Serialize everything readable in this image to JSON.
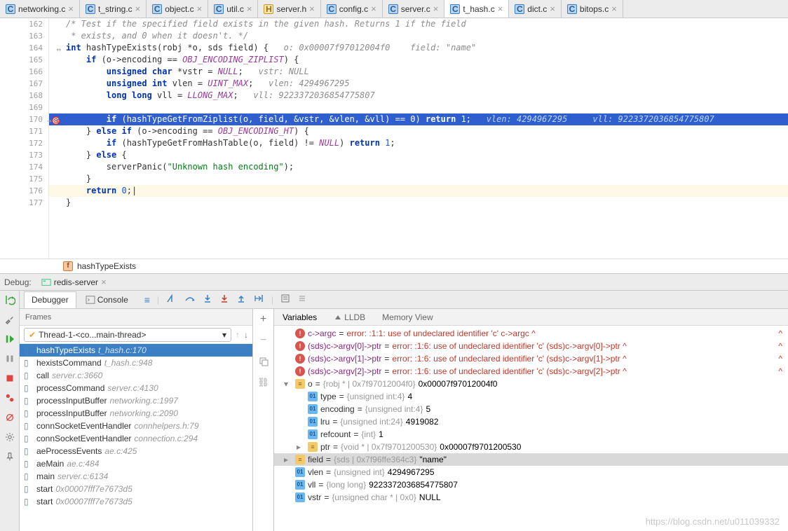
{
  "tabs": [
    {
      "name": "networking.c",
      "icon": "c"
    },
    {
      "name": "t_string.c",
      "icon": "c"
    },
    {
      "name": "object.c",
      "icon": "c"
    },
    {
      "name": "util.c",
      "icon": "c"
    },
    {
      "name": "server.h",
      "icon": "h"
    },
    {
      "name": "config.c",
      "icon": "c"
    },
    {
      "name": "server.c",
      "icon": "c"
    },
    {
      "name": "t_hash.c",
      "icon": "c",
      "active": true
    },
    {
      "name": "dict.c",
      "icon": "c"
    },
    {
      "name": "bitops.c",
      "icon": "c"
    }
  ],
  "editor": {
    "lines": [
      {
        "n": 162,
        "html": "/* Test if the specified field exists in the given hash. Returns 1 if the field",
        "cls": "cm"
      },
      {
        "n": 163,
        "html": " * exists, and 0 when it doesn't. */",
        "cls": "cm"
      },
      {
        "n": 164,
        "segments": [
          [
            "ty",
            "int"
          ],
          [
            "",
            " hashTypeExists(robj *o, sds field) {   "
          ],
          [
            "hint",
            "o: 0x00007f97012004f0    field: \"name\""
          ]
        ],
        "mark": "↔"
      },
      {
        "n": 165,
        "segments": [
          [
            "",
            "    "
          ],
          [
            "kw",
            "if"
          ],
          [
            "",
            " (o->encoding == "
          ],
          [
            "mac",
            "OBJ_ENCODING_ZIPLIST"
          ],
          [
            "",
            ") {"
          ]
        ]
      },
      {
        "n": 166,
        "segments": [
          [
            "",
            "        "
          ],
          [
            "ty",
            "unsigned char"
          ],
          [
            "",
            " *vstr = "
          ],
          [
            "mac",
            "NULL"
          ],
          [
            "",
            ";   "
          ],
          [
            "hint",
            "vstr: NULL"
          ]
        ]
      },
      {
        "n": 167,
        "segments": [
          [
            "",
            "        "
          ],
          [
            "ty",
            "unsigned int"
          ],
          [
            "",
            " vlen = "
          ],
          [
            "mac",
            "UINT_MAX"
          ],
          [
            "",
            ";   "
          ],
          [
            "hint",
            "vlen: 4294967295"
          ]
        ]
      },
      {
        "n": 168,
        "segments": [
          [
            "",
            "        "
          ],
          [
            "ty",
            "long long"
          ],
          [
            "",
            " vll = "
          ],
          [
            "mac",
            "LLONG_MAX"
          ],
          [
            "",
            ";   "
          ],
          [
            "hint",
            "vll: 9223372036854775807"
          ]
        ]
      },
      {
        "n": 169,
        "segments": [
          [
            "",
            ""
          ]
        ]
      },
      {
        "n": 170,
        "exec": true,
        "mark": "→🎯",
        "segments": [
          [
            "",
            "        "
          ],
          [
            "kw",
            "if"
          ],
          [
            "",
            " (hashTypeGetFromZiplist(o, field, &vstr, &vlen, &vll) == "
          ],
          [
            "num",
            "0"
          ],
          [
            "",
            ") "
          ],
          [
            "kw",
            "return"
          ],
          [
            "",
            " "
          ],
          [
            "num",
            "1"
          ],
          [
            "",
            ";   "
          ],
          [
            "hint-exec",
            "vlen: 4294967295     vll: 9223372036854775807"
          ]
        ]
      },
      {
        "n": 171,
        "segments": [
          [
            "",
            "    } "
          ],
          [
            "kw",
            "else if"
          ],
          [
            "",
            " (o->encoding == "
          ],
          [
            "mac",
            "OBJ_ENCODING_HT"
          ],
          [
            "",
            ") {"
          ]
        ]
      },
      {
        "n": 172,
        "segments": [
          [
            "",
            "        "
          ],
          [
            "kw",
            "if"
          ],
          [
            "",
            " (hashTypeGetFromHashTable(o, field) != "
          ],
          [
            "mac",
            "NULL"
          ],
          [
            "",
            ") "
          ],
          [
            "kw",
            "return"
          ],
          [
            "",
            " "
          ],
          [
            "num",
            "1"
          ],
          [
            "",
            ";"
          ]
        ]
      },
      {
        "n": 173,
        "segments": [
          [
            "",
            "    } "
          ],
          [
            "kw",
            "else"
          ],
          [
            "",
            " {"
          ]
        ]
      },
      {
        "n": 174,
        "segments": [
          [
            "",
            "        serverPanic("
          ],
          [
            "str",
            "\"Unknown hash encoding\""
          ],
          [
            "",
            ");"
          ]
        ]
      },
      {
        "n": 175,
        "segments": [
          [
            "",
            "    }"
          ]
        ]
      },
      {
        "n": 176,
        "cursor": true,
        "segments": [
          [
            "",
            "    "
          ],
          [
            "kw",
            "return"
          ],
          [
            "",
            " "
          ],
          [
            "num",
            "0"
          ],
          [
            "",
            ";|"
          ]
        ]
      },
      {
        "n": 177,
        "segments": [
          [
            "",
            "}"
          ]
        ]
      }
    ],
    "breadcrumb": "hashTypeExists"
  },
  "debug": {
    "label": "Debug:",
    "target": "redis-server",
    "tabs": {
      "debugger": "Debugger",
      "console": "Console"
    },
    "frames_label": "Frames",
    "thread": "Thread-1-<co...main-thread>",
    "frames": [
      {
        "name": "hashTypeExists",
        "loc": "t_hash.c:170",
        "selected": true
      },
      {
        "name": "hexistsCommand",
        "loc": "t_hash.c:948"
      },
      {
        "name": "call",
        "loc": "server.c:3660"
      },
      {
        "name": "processCommand",
        "loc": "server.c:4130"
      },
      {
        "name": "processInputBuffer",
        "loc": "networking.c:1997"
      },
      {
        "name": "processInputBuffer",
        "loc": "networking.c:2090"
      },
      {
        "name": "connSocketEventHandler",
        "loc": "connhelpers.h:79"
      },
      {
        "name": "connSocketEventHandler",
        "loc": "connection.c:294"
      },
      {
        "name": "aeProcessEvents",
        "loc": "ae.c:425"
      },
      {
        "name": "aeMain",
        "loc": "ae.c:484"
      },
      {
        "name": "main",
        "loc": "server.c:6134"
      },
      {
        "name": "start",
        "loc": "0x00007fff7e7673d5"
      },
      {
        "name": "start",
        "loc": "0x00007fff7e7673d5"
      }
    ],
    "vars_tabs": {
      "variables": "Variables",
      "lldb": "LLDB",
      "memory": "Memory View"
    },
    "vars": [
      {
        "type": "err",
        "name": "c->argc",
        "val": "error: <user expression 151>:1:1: use of undeclared identifier 'c' c->argc ^"
      },
      {
        "type": "err",
        "name": "(sds)c->argv[0]->ptr",
        "val": "error: <user expression 153>:1:6: use of undeclared identifier 'c' (sds)c->argv[0]->ptr     ^"
      },
      {
        "type": "err",
        "name": "(sds)c->argv[1]->ptr",
        "val": "error: <user expression 155>:1:6: use of undeclared identifier 'c' (sds)c->argv[1]->ptr     ^"
      },
      {
        "type": "err",
        "name": "(sds)c->argv[2]->ptr",
        "val": "error: <user expression 157>:1:6: use of undeclared identifier 'c' (sds)c->argv[2]->ptr     ^"
      },
      {
        "type": "obj",
        "indent": 0,
        "exp": "open",
        "name": "o",
        "meta": "{robj * | 0x7f97012004f0}",
        "val": "0x00007f97012004f0"
      },
      {
        "type": "int",
        "indent": 1,
        "name": "type",
        "meta": "{unsigned int:4}",
        "val": "4"
      },
      {
        "type": "int",
        "indent": 1,
        "name": "encoding",
        "meta": "{unsigned int:4}",
        "val": "5"
      },
      {
        "type": "int",
        "indent": 1,
        "name": "lru",
        "meta": "{unsigned int:24}",
        "val": "4919082"
      },
      {
        "type": "int",
        "indent": 1,
        "name": "refcount",
        "meta": "{int}",
        "val": "1"
      },
      {
        "type": "obj",
        "indent": 1,
        "exp": "closed",
        "name": "ptr",
        "meta": "{void * | 0x7f9701200530}",
        "val": "0x00007f9701200530"
      },
      {
        "type": "obj",
        "indent": 0,
        "exp": "closed",
        "name": "field",
        "meta": "{sds | 0x7f96ffe364c3}",
        "val": "\"name\"",
        "selected": true
      },
      {
        "type": "int",
        "indent": 0,
        "name": "vlen",
        "meta": "{unsigned int}",
        "val": "4294967295"
      },
      {
        "type": "int",
        "indent": 0,
        "name": "vll",
        "meta": "{long long}",
        "val": "9223372036854775807"
      },
      {
        "type": "int",
        "indent": 0,
        "name": "vstr",
        "meta": "{unsigned char * | 0x0}",
        "val": "NULL"
      }
    ]
  },
  "watermark": "https://blog.csdn.net/u011039332"
}
